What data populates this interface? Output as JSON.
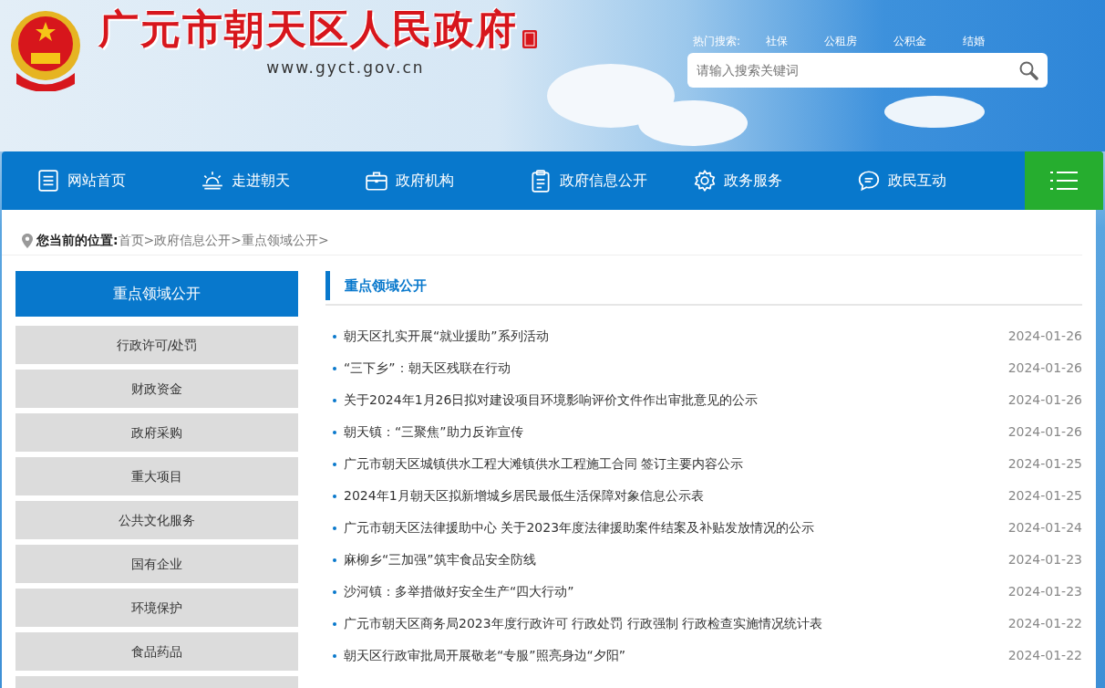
{
  "header": {
    "site_title": "广元市朝天区人民政府",
    "domain": "www.gyct.gov.cn",
    "hot_search": {
      "label": "热门搜索:",
      "terms": [
        "社保",
        "公租房",
        "公积金",
        "结婚"
      ]
    },
    "search": {
      "placeholder": "请输入搜索关键词"
    }
  },
  "nav": [
    {
      "label": "网站首页"
    },
    {
      "label": "走进朝天"
    },
    {
      "label": "政府机构"
    },
    {
      "label": "政府信息公开"
    },
    {
      "label": "政务服务"
    },
    {
      "label": "政民互动"
    }
  ],
  "breadcrumb": {
    "label": "您当前的位置:",
    "separator": ">",
    "items": [
      "首页",
      "政府信息公开",
      "重点领域公开"
    ]
  },
  "sidebar": {
    "title": "重点领域公开",
    "items": [
      {
        "label": "行政许可/处罚",
        "selected": false
      },
      {
        "label": "财政资金",
        "selected": false
      },
      {
        "label": "政府采购",
        "selected": false
      },
      {
        "label": "重大项目",
        "selected": false
      },
      {
        "label": "公共文化服务",
        "selected": false
      },
      {
        "label": "国有企业",
        "selected": false
      },
      {
        "label": "环境保护",
        "selected": false
      },
      {
        "label": "食品药品",
        "selected": false
      }
    ]
  },
  "section": {
    "title": "重点领域公开",
    "articles": [
      {
        "title": "朝天区扎实开展“就业援助”系列活动",
        "date": "2024-01-26"
      },
      {
        "title": "“三下乡”：朝天区残联在行动",
        "date": "2024-01-26"
      },
      {
        "title": "关于2024年1月26日拟对建设项目环境影响评价文件作出审批意见的公示",
        "date": "2024-01-26"
      },
      {
        "title": "朝天镇：“三聚焦”助力反诈宣传",
        "date": "2024-01-26"
      },
      {
        "title": "广元市朝天区城镇供水工程大滩镇供水工程施工合同 签订主要内容公示",
        "date": "2024-01-25"
      },
      {
        "title": "2024年1月朝天区拟新增城乡居民最低生活保障对象信息公示表",
        "date": "2024-01-25"
      },
      {
        "title": "广元市朝天区法律援助中心 关于2023年度法律援助案件结案及补贴发放情况的公示",
        "date": "2024-01-24"
      },
      {
        "title": "麻柳乡“三加强”筑牢食品安全防线",
        "date": "2024-01-23"
      },
      {
        "title": "沙河镇：多举措做好安全生产“四大行动”",
        "date": "2024-01-23"
      },
      {
        "title": "广元市朝天区商务局2023年度行政许可 行政处罚 行政强制 行政检查实施情况统计表",
        "date": "2024-01-22"
      },
      {
        "title": "朝天区行政审批局开展敬老“专服”照亮身边“夕阳”",
        "date": "2024-01-22"
      }
    ]
  }
}
